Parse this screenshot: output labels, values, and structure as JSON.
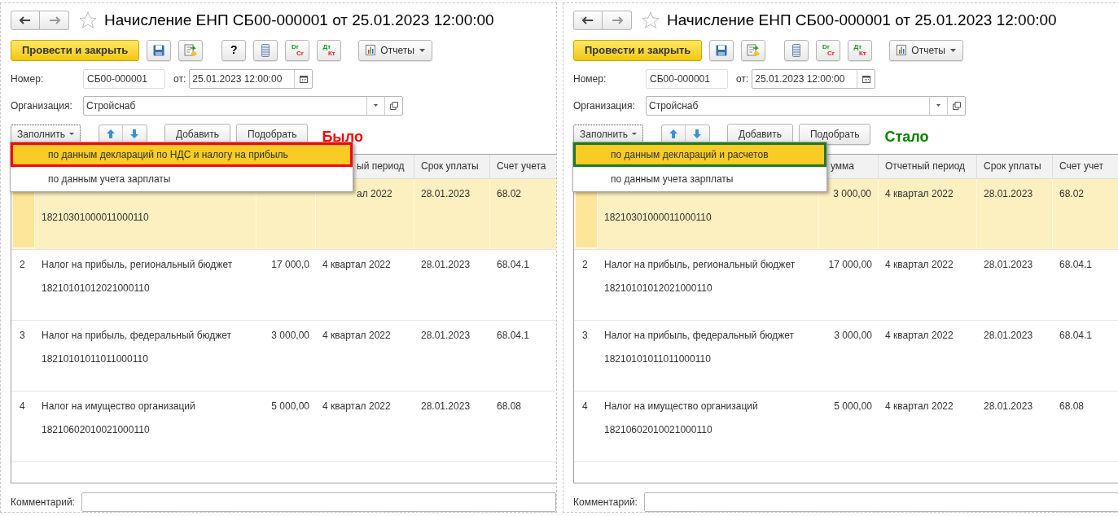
{
  "panels": [
    {
      "title": "Начисление ЕНП СБ00-000001 от 25.01.2023 12:00:00",
      "toolbar": [
        {
          "kind": "primary",
          "label": "Провести и закрыть"
        },
        {
          "kind": "save"
        },
        {
          "kind": "post"
        },
        {
          "kind": "help",
          "label": "?"
        },
        {
          "kind": "list"
        },
        {
          "kind": "ledger",
          "top": "Dr",
          "bottom": "Cr"
        },
        {
          "kind": "ledger",
          "top": "Дт",
          "bottom": "Кт"
        },
        {
          "kind": "reports",
          "label": "Отчеты"
        }
      ],
      "number_label": "Номер:",
      "number": "СБ00-000001",
      "date_label": "от:",
      "date": "25.01.2023 12:00:00",
      "org_label": "Организация:",
      "org": "Стройснаб",
      "fill_button": "Заполнить",
      "add_button": "Добавить",
      "pick_button": "Подобрать",
      "annotation": {
        "text": "Было",
        "color": "#ff0000"
      },
      "menu": [
        {
          "label": "по данным деклараций по НДС и налогу на прибыль",
          "selected": true
        },
        {
          "label": "по данным учета зарплаты",
          "selected": false
        }
      ],
      "columns": [
        "ый период",
        "Срок уплаты",
        "Счет учета"
      ],
      "rows": [
        {
          "selected": true,
          "code": "18210301000011000110",
          "period": "ал 2022",
          "due": "28.01.2023",
          "account": "68.02"
        },
        {
          "selected": false,
          "n": "2",
          "name": "Налог на прибыль, региональный бюджет",
          "code": "18210101012021000110",
          "sum": "17 000,0",
          "period": "4 квартал 2022",
          "due": "28.01.2023",
          "account": "68.04.1"
        },
        {
          "selected": false,
          "n": "3",
          "name": "Налог на прибыль, федеральный бюджет",
          "code": "18210101011011000110",
          "sum": "3 000,00",
          "period": "4 квартал 2022",
          "due": "28.01.2023",
          "account": "68.04.1"
        },
        {
          "selected": false,
          "n": "4",
          "name": "Налог на имущество организаций",
          "code": "18210602010021000110",
          "sum": "5 000,00",
          "period": "4 квартал 2022",
          "due": "28.01.2023",
          "account": "68.08"
        }
      ],
      "comment_label": "Комментарий:"
    },
    {
      "title": "Начисление ЕНП СБ00-000001 от 25.01.2023 12:00:00",
      "toolbar": [
        {
          "kind": "primary",
          "label": "Провести и закрыть"
        },
        {
          "kind": "save"
        },
        {
          "kind": "post"
        },
        {
          "kind": "list"
        },
        {
          "kind": "ledger",
          "top": "Dr",
          "bottom": "Cr"
        },
        {
          "kind": "ledger",
          "top": "Дт",
          "bottom": "Кт"
        },
        {
          "kind": "reports",
          "label": "Отчеты"
        }
      ],
      "number_label": "Номер:",
      "number": "СБ00-000001",
      "date_label": "от:",
      "date": "25.01.2023 12:00:00",
      "org_label": "Организация:",
      "org": "Стройснаб",
      "fill_button": "Заполнить",
      "add_button": "Добавить",
      "pick_button": "Подобрать",
      "annotation": {
        "text": "Стало",
        "color": "#008000"
      },
      "menu": [
        {
          "label": "по данным деклараций и расчетов",
          "selected": true
        },
        {
          "label": "по данным учета зарплаты",
          "selected": false
        }
      ],
      "columns": [
        "умма",
        "Отчетный период",
        "Срок уплаты",
        "Счет учет"
      ],
      "rows": [
        {
          "selected": true,
          "code": "18210301000011000110",
          "sum": "3 000,00",
          "period": "4 квартал 2022",
          "due": "28.01.2023",
          "account": "68.02"
        },
        {
          "selected": false,
          "n": "2",
          "name": "Налог на прибыль, региональный бюджет",
          "code": "18210101012021000110",
          "sum": "17 000,00",
          "period": "4 квартал 2022",
          "due": "28.01.2023",
          "account": "68.04.1"
        },
        {
          "selected": false,
          "n": "3",
          "name": "Налог на прибыль, федеральный бюджет",
          "code": "18210101011011000110",
          "sum": "3 000,00",
          "period": "4 квартал 2022",
          "due": "28.01.2023",
          "account": "68.04.1"
        },
        {
          "selected": false,
          "n": "4",
          "name": "Налог на имущество организаций",
          "code": "18210602010021000110",
          "sum": "5 000,00",
          "period": "4 квартал 2022",
          "due": "28.01.2023",
          "account": "68.08"
        }
      ],
      "comment_label": "Комментарий:"
    }
  ]
}
